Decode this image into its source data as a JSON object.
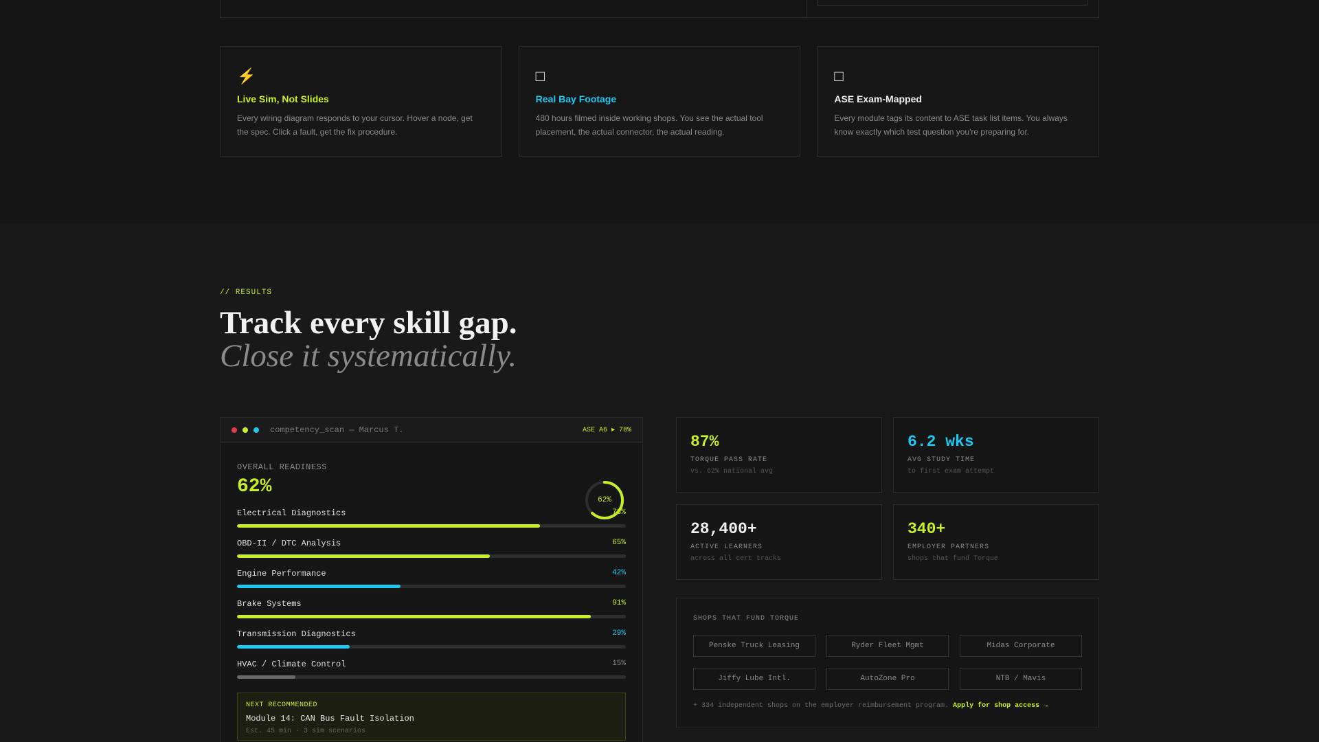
{
  "features": [
    {
      "icon": "⚡",
      "icon_name": "lightning-icon",
      "title": "Live Sim, Not Slides",
      "desc": "Every wiring diagram responds to your cursor. Hover a node, get the spec. Click a fault, get the fix procedure.",
      "accent": "#c6f024"
    },
    {
      "icon": "□",
      "icon_name": "video-icon",
      "title": "Real Bay Footage",
      "desc": "480 hours filmed inside working shops. You see the actual tool placement, the actual connector, the actual reading.",
      "accent": "#1ec8f0"
    },
    {
      "icon": "□",
      "icon_name": "clipboard-icon",
      "title": "ASE Exam-Mapped",
      "desc": "Every module tags its content to ASE task list items. You always know exactly which test question you're preparing for.",
      "accent": "#f0f0f0"
    }
  ],
  "results": {
    "eyebrow": "// RESULTS",
    "headline": "Track every skill gap.",
    "subline": "Close it systematically."
  },
  "scan": {
    "title": "competency_scan — Marcus T.",
    "badge": "ASE A6 ▸ 78%",
    "readiness_label": "OVERALL READINESS",
    "readiness_value": "62%",
    "readiness_fraction": 0.62,
    "ring_text": "62%",
    "skills": [
      {
        "name": "Electrical Diagnostics",
        "pct": "78%",
        "value": 0.78,
        "color": "#c6f024"
      },
      {
        "name": "OBD-II / DTC Analysis",
        "pct": "65%",
        "value": 0.65,
        "color": "#c6f024"
      },
      {
        "name": "Engine Performance",
        "pct": "42%",
        "value": 0.42,
        "color": "#1ec8f0"
      },
      {
        "name": "Brake Systems",
        "pct": "91%",
        "value": 0.91,
        "color": "#c6f024"
      },
      {
        "name": "Transmission Diagnostics",
        "pct": "29%",
        "value": 0.29,
        "color": "#1ec8f0"
      },
      {
        "name": "HVAC / Climate Control",
        "pct": "15%",
        "value": 0.15,
        "color": "#6a6a6a"
      }
    ],
    "next_label": "NEXT RECOMMENDED",
    "next_title": "Module 14: CAN Bus Fault Isolation",
    "next_meta": "Est. 45 min · 3 sim scenarios"
  },
  "stats": [
    {
      "value": "87%",
      "label": "TORQUE PASS RATE",
      "sub": "vs. 62% national avg",
      "color": "#c6f024"
    },
    {
      "value": "6.2 wks",
      "label": "AVG STUDY TIME",
      "sub": "to first exam attempt",
      "color": "#1ec8f0"
    },
    {
      "value": "28,400+",
      "label": "ACTIVE LEARNERS",
      "sub": "across all cert tracks",
      "color": "#f0f0f0"
    },
    {
      "value": "340+",
      "label": "EMPLOYER PARTNERS",
      "sub": "shops that fund Torque",
      "color": "#c6f024"
    }
  ],
  "shops": {
    "label": "SHOPS THAT FUND TORQUE",
    "chips": [
      "Penske Truck Leasing",
      "Ryder Fleet Mgmt",
      "Midas Corporate",
      "Jiffy Lube Intl.",
      "AutoZone Pro",
      "NTB / Mavis"
    ],
    "note": "+ 334 independent shops on the employer reimbursement program.",
    "link": "Apply for shop access →"
  },
  "colors": {
    "lime": "#c6f024",
    "cyan": "#1ec8f0",
    "dot_red": "#e8394a",
    "dot_lime": "#c6f024",
    "dot_cyan": "#1ec8f0"
  }
}
